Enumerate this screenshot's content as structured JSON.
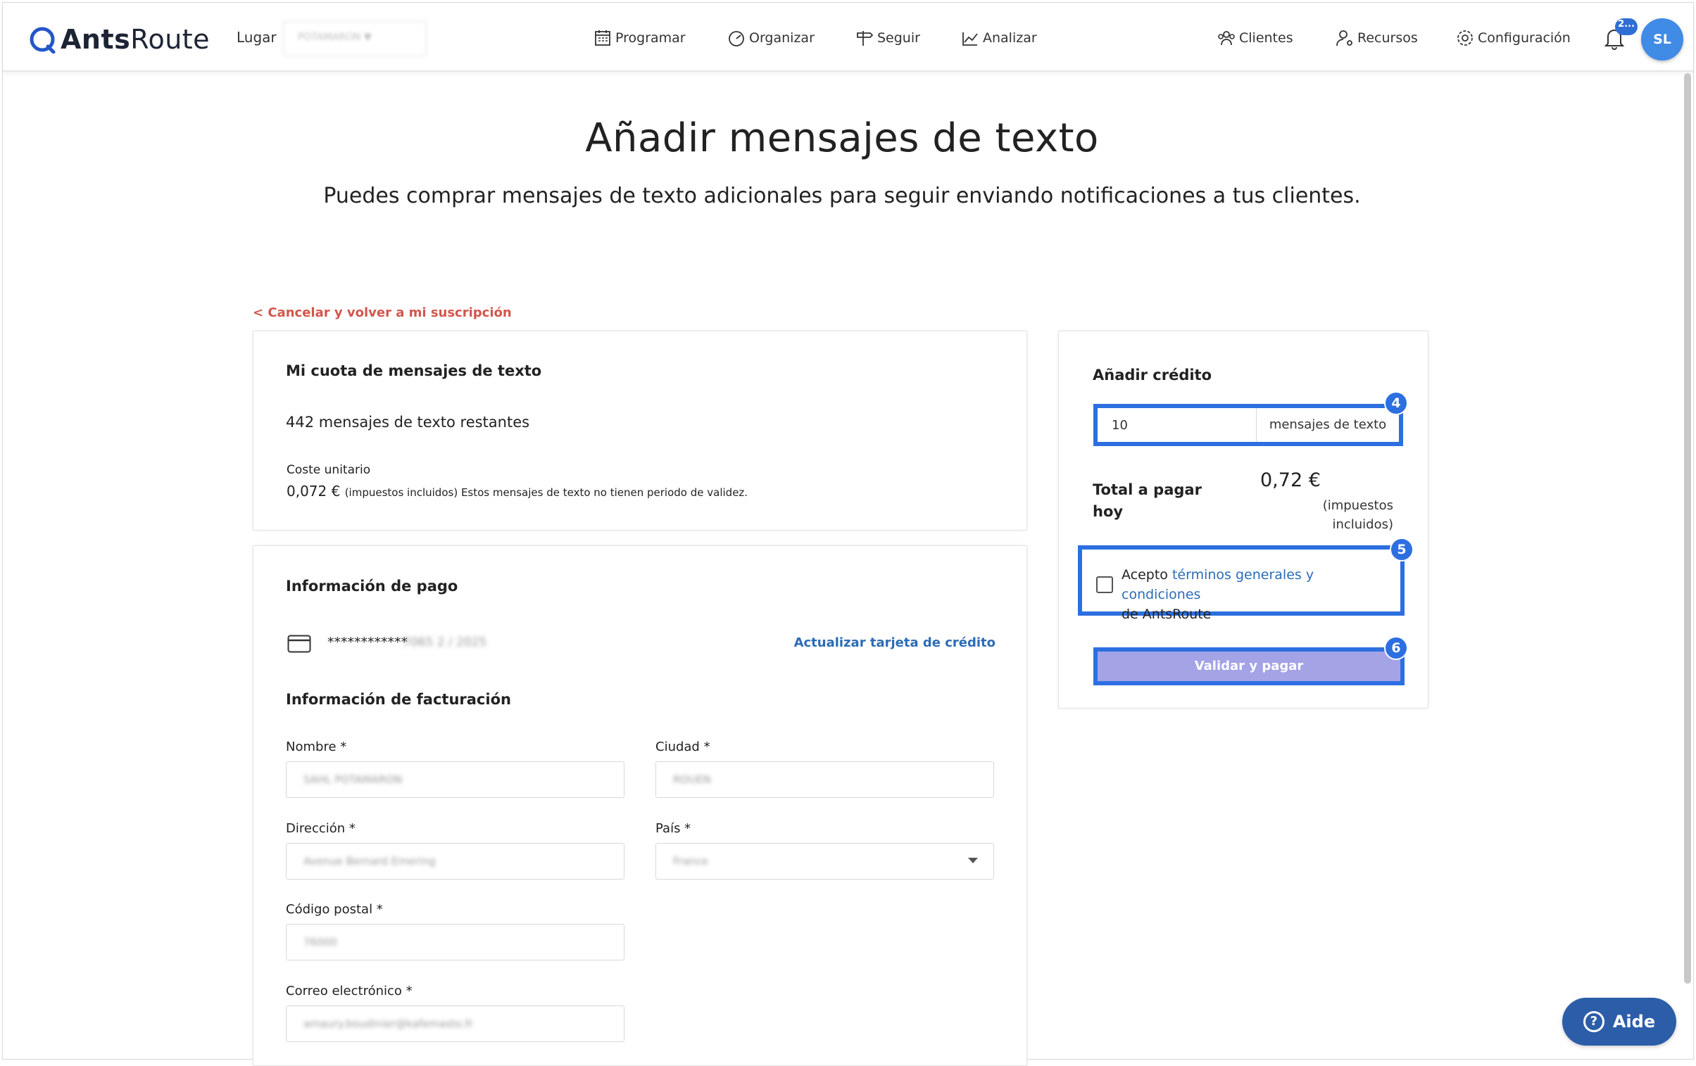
{
  "app": {
    "logo_text_bold": "Ants",
    "logo_text_light": "Route"
  },
  "header": {
    "lugar_label": "Lugar",
    "lugar_value": "POTAMARON ▼",
    "nav": [
      {
        "label": "Programar",
        "icon": "calendar-icon"
      },
      {
        "label": "Organizar",
        "icon": "speedometer-icon"
      },
      {
        "label": "Seguir",
        "icon": "signpost-icon"
      },
      {
        "label": "Analizar",
        "icon": "chart-icon"
      },
      {
        "label": "Clientes",
        "icon": "customers-icon"
      },
      {
        "label": "Recursos",
        "icon": "resources-icon"
      },
      {
        "label": "Configuración",
        "icon": "gear-icon"
      }
    ],
    "notification_badge": "2...",
    "avatar_initials": "SL"
  },
  "page": {
    "title": "Añadir mensajes de texto",
    "subtitle": "Puedes comprar mensajes de texto adicionales para seguir enviando notificaciones a tus clientes.",
    "cancel_link": "< Cancelar y volver a mi suscripción"
  },
  "quota": {
    "title": "Mi cuota de mensajes de texto",
    "remaining": "442 mensajes de texto restantes",
    "unit_cost_label": "Coste unitario",
    "unit_cost_value": "0,072 €",
    "unit_cost_note": "(impuestos incluidos) Estos mensajes de texto no tienen periodo de validez."
  },
  "payment": {
    "title": "Información de pago",
    "card_number_masked": "************",
    "card_tail": "7065   2 / 2025",
    "update_card_link": "Actualizar tarjeta de crédito"
  },
  "billing": {
    "title": "Información de facturación",
    "fields": {
      "nombre": {
        "label": "Nombre *",
        "value": "SAHL POTAMARON"
      },
      "ciudad": {
        "label": "Ciudad *",
        "value": "ROUEN"
      },
      "direccion": {
        "label": "Dirección *",
        "value": "Avenue Bernard Emering"
      },
      "pais": {
        "label": "País *",
        "value": "France"
      },
      "codigo_postal": {
        "label": "Código postal *",
        "value": "76000"
      },
      "correo": {
        "label": "Correo electrónico *",
        "value": "amaury.boudinier@kafemasto.fr"
      }
    }
  },
  "credit": {
    "title": "Añadir crédito",
    "quantity": "10",
    "unit": "mensajes de texto",
    "total_label": "Total a pagar hoy",
    "total_value": "0,72 €",
    "total_note": "(impuestos incluidos)",
    "terms_prefix": "Acepto ",
    "terms_link": "términos generales y condiciones",
    "terms_suffix": "de AntsRoute",
    "pay_button": "Validar y pagar",
    "steps": [
      "4",
      "5",
      "6"
    ]
  },
  "help_button": "Aide",
  "colors": {
    "accent_blue": "#2d6fe0",
    "link_blue": "#2c6cb6",
    "cancel_red": "#d2564d",
    "pay_button_bg": "#a3a3e6",
    "avatar_bg": "#3f8be6",
    "help_bg": "#2c5da8"
  }
}
